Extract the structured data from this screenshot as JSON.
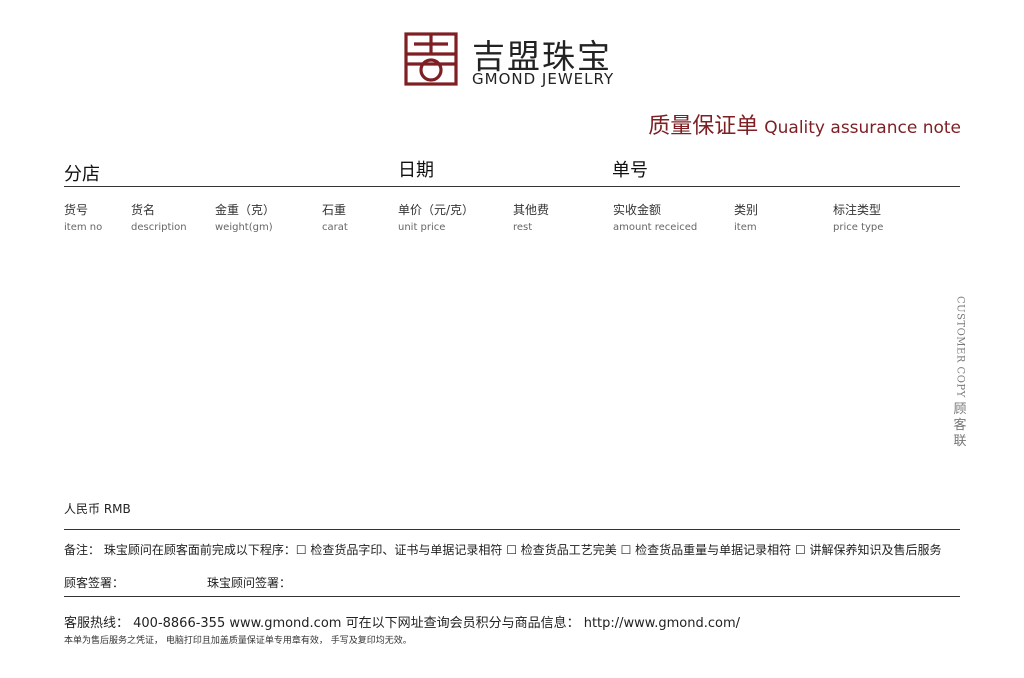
{
  "brand": {
    "name_cn": "吉盟珠宝",
    "name_en": "GMOND JEWELRY",
    "color": "#7d1f23"
  },
  "document": {
    "title_cn": "质量保证单",
    "title_en": "Quality assurance note"
  },
  "header": {
    "branch_label": "分店",
    "date_label": "日期",
    "number_label": "单号"
  },
  "columns": [
    {
      "cn": "货号",
      "en": "item no"
    },
    {
      "cn": "货名",
      "en": "description"
    },
    {
      "cn": "金重（克）",
      "en": "weight(gm)"
    },
    {
      "cn": "石重",
      "en": "carat"
    },
    {
      "cn": "单价（元/克）",
      "en": "unit price"
    },
    {
      "cn": "其他费",
      "en": "rest"
    },
    {
      "cn": "实收金额",
      "en": "amount receiced"
    },
    {
      "cn": "类别",
      "en": "item"
    },
    {
      "cn": "标注类型",
      "en": "price type"
    }
  ],
  "side_label": {
    "en": "CUSTOMER COPY",
    "cn": "顾客联"
  },
  "currency_label": "人民币 RMB",
  "remarks": "备注：   珠宝顾问在顾客面前完成以下程序：☐ 检查货品字印、证书与单据记录相符  ☐ 检查货品工艺完美  ☐ 检查货品重量与单据记录相符  ☐ 讲解保养知识及售后服务",
  "signatures": {
    "customer": "顾客签署：",
    "advisor": "珠宝顾问签署："
  },
  "footer": {
    "hotline": "客服热线：  400-8866-355   www.gmond.com   可在以下网址查询会员积分与商品信息：  http://www.gmond.com/",
    "disclaimer": "本单为售后服务之凭证，  电脑打印且加盖质量保证单专用章有效，  手写及复印均无效。"
  }
}
